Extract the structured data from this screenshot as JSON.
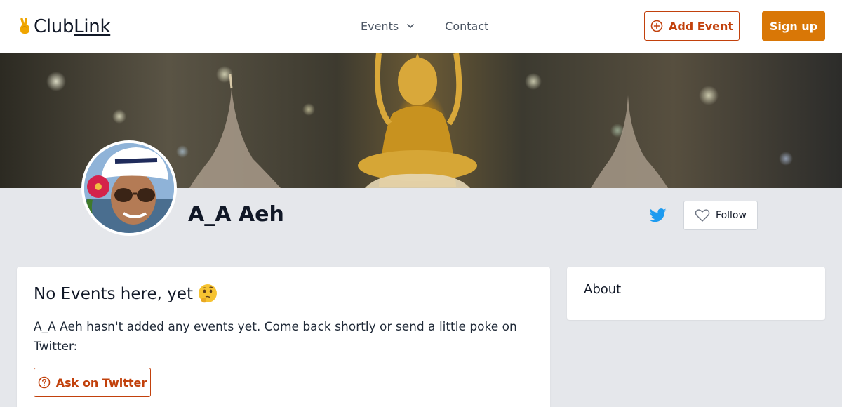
{
  "brand": {
    "name_part1": "Club",
    "name_part2": "Link",
    "accent_color": "#c2410c",
    "primary_color": "#d97706"
  },
  "nav": {
    "events_label": "Events",
    "contact_label": "Contact"
  },
  "header_actions": {
    "add_event_label": "Add Event",
    "sign_up_label": "Sign up"
  },
  "profile": {
    "name": "A_A Aeh",
    "follow_label": "Follow",
    "twitter_icon": "twitter-icon"
  },
  "events_card": {
    "title": "No Events here, yet",
    "emoji_icon": "thinking-face-icon",
    "message": "A_A Aeh hasn't added any events yet. Come back shortly or send a little poke on Twitter:",
    "ask_label": "Ask on Twitter"
  },
  "about_card": {
    "title": "About"
  }
}
